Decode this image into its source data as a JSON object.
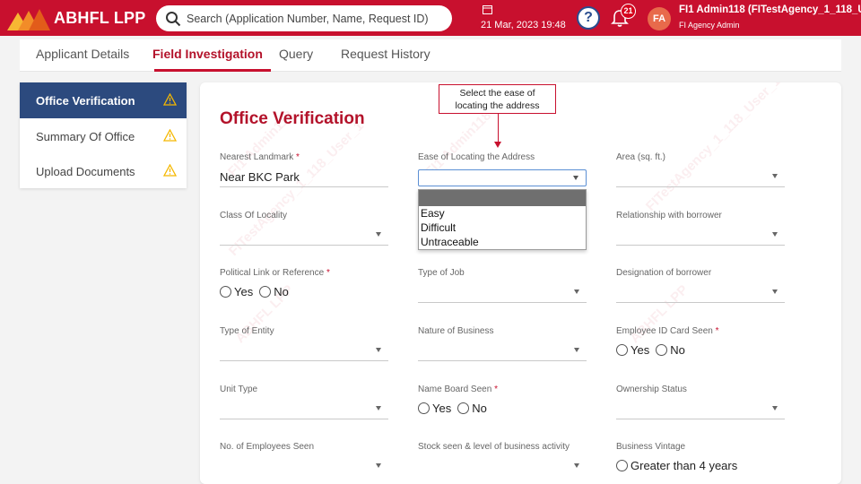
{
  "header": {
    "brand": "ABHFL LPP",
    "search_placeholder": "Search (Application Number, Name, Request ID)",
    "datetime": "21 Mar, 2023 19:48",
    "help_label": "?",
    "notification_count": "21",
    "avatar_initials": "FA",
    "user_name": "FI1 Admin118 (FITestAgency_1_118_Use",
    "user_role": "FI Agency Admin"
  },
  "tabs": [
    {
      "label": "Applicant Details"
    },
    {
      "label": "Field Investigation"
    },
    {
      "label": "Query"
    },
    {
      "label": "Request History"
    }
  ],
  "sidebar": {
    "items": [
      {
        "label": "Office Verification"
      },
      {
        "label": "Summary Of Office"
      },
      {
        "label": "Upload Documents"
      }
    ]
  },
  "form": {
    "title": "Office Verification",
    "required_mark": "*",
    "fields": {
      "nearest_landmark": {
        "label": "Nearest Landmark",
        "value": "Near BKC Park"
      },
      "ease_of_locating": {
        "label": "Ease of Locating the Address",
        "value": ""
      },
      "area": {
        "label": "Area (sq. ft.)",
        "value": ""
      },
      "class_of_locality": {
        "label": "Class Of Locality",
        "value": ""
      },
      "relationship_with_borrower": {
        "label": "Relationship with borrower",
        "value": ""
      },
      "political_link": {
        "label": "Political Link or Reference"
      },
      "type_of_job": {
        "label": "Type of Job",
        "value": ""
      },
      "designation": {
        "label": "Designation of borrower",
        "value": ""
      },
      "type_of_entity": {
        "label": "Type of Entity",
        "value": ""
      },
      "nature_of_business": {
        "label": "Nature of Business",
        "value": ""
      },
      "employee_id_card": {
        "label": "Employee ID Card Seen"
      },
      "unit_type": {
        "label": "Unit Type",
        "value": ""
      },
      "name_board_seen": {
        "label": "Name Board Seen"
      },
      "ownership_status": {
        "label": "Ownership Status",
        "value": ""
      },
      "no_of_employees": {
        "label": "No. of Employees Seen",
        "value": ""
      },
      "stock_seen": {
        "label": "Stock seen & level of business activity",
        "value": ""
      },
      "business_vintage": {
        "label": "Business Vintage"
      }
    },
    "radio": {
      "yes": "Yes",
      "no": "No",
      "greater_than_4": "Greater than 4 years"
    },
    "ease_options": [
      "",
      "Easy",
      "Difficult",
      "Untraceable"
    ]
  },
  "callout": {
    "text_line1": "Select the ease of",
    "text_line2": "locating the address"
  },
  "watermark": {
    "line1": "FI1 Admin118",
    "line2": "FITestAgency_1_118_User_1",
    "line3": "ABHFL LPP"
  },
  "colors": {
    "brand_red": "#c8102e",
    "nav_blue": "#2c4a7e",
    "warning": "#f5b800"
  }
}
